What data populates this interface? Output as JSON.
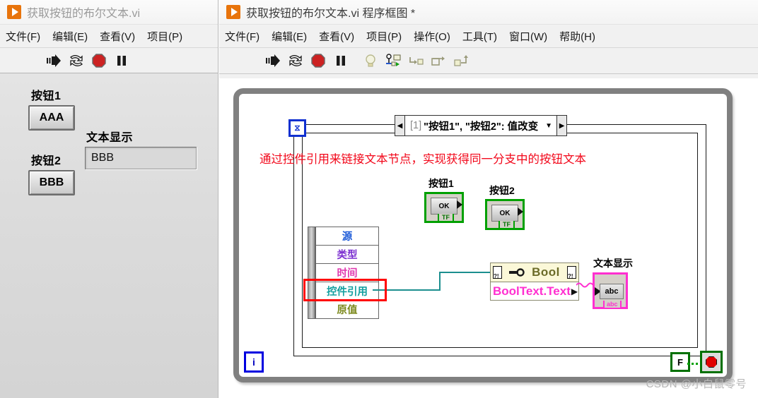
{
  "left_window": {
    "title": "获取按钮的布尔文本.vi",
    "icon": "labview-vi-icon",
    "menu": [
      {
        "label": "文件(F)"
      },
      {
        "label": "编辑(E)"
      },
      {
        "label": "查看(V)"
      },
      {
        "label": "项目(P)"
      }
    ],
    "toolbar": [
      {
        "name": "run-button",
        "glyph": "run-arrow-icon"
      },
      {
        "name": "run-continuously-button",
        "glyph": "run-continuously-icon"
      },
      {
        "name": "abort-execution-button",
        "glyph": "abort-stop-icon"
      },
      {
        "name": "pause-button",
        "glyph": "pause-icon"
      }
    ],
    "front_panel": {
      "button1_label": "按钮1",
      "button1_text": "AAA",
      "button2_label": "按钮2",
      "button2_text": "BBB",
      "indicator_label": "文本显示",
      "indicator_value": "BBB"
    }
  },
  "right_window": {
    "title": "获取按钮的布尔文本.vi 程序框图 *",
    "icon": "labview-vi-icon",
    "menu": [
      {
        "label": "文件(F)"
      },
      {
        "label": "编辑(E)"
      },
      {
        "label": "查看(V)"
      },
      {
        "label": "项目(P)"
      },
      {
        "label": "操作(O)"
      },
      {
        "label": "工具(T)"
      },
      {
        "label": "窗口(W)"
      },
      {
        "label": "帮助(H)"
      }
    ],
    "toolbar": [
      {
        "name": "run-button",
        "glyph": "run-arrow-icon"
      },
      {
        "name": "run-continuously-button",
        "glyph": "run-continuously-icon"
      },
      {
        "name": "abort-execution-button",
        "glyph": "abort-stop-icon"
      },
      {
        "name": "pause-button",
        "glyph": "pause-icon"
      },
      {
        "name": "highlight-execution-button",
        "glyph": "lightbulb-icon"
      },
      {
        "name": "retain-wire-values-button",
        "glyph": "probe-retain-icon"
      },
      {
        "name": "step-into-button",
        "glyph": "step-into-icon"
      },
      {
        "name": "step-over-button",
        "glyph": "step-over-icon"
      },
      {
        "name": "step-out-button",
        "glyph": "step-out-icon"
      }
    ],
    "diagram": {
      "event_case_index": "[1]",
      "event_case_label": "\"按钮1\", \"按钮2\": 值改变",
      "annotation": "通过控件引用来链接文本节点，实现获得同一分支中的按钮文本",
      "terminals": [
        {
          "label": "按钮1",
          "glyph": "OK",
          "type": "TF"
        },
        {
          "label": "按钮2",
          "glyph": "OK",
          "type": "TF"
        }
      ],
      "event_data_node": [
        {
          "label": "源",
          "color": "#1e5bd8"
        },
        {
          "label": "类型",
          "color": "#7b2fd0"
        },
        {
          "label": "时间",
          "color": "#e03ab0"
        },
        {
          "label": "控件引用",
          "color": "#14a0a0",
          "highlighted": true
        },
        {
          "label": "原值",
          "color": "#7d8a1e"
        }
      ],
      "property_node": {
        "title": "Bool",
        "property": "BoolText.Text"
      },
      "indicator": {
        "label": "文本显示",
        "glyph": "abc"
      },
      "loop": {
        "iteration_terminal": "i",
        "stop_constant": "F",
        "conditional_terminal": "stop-sign-icon"
      }
    }
  },
  "watermark": "CSDN @小白鼠零号",
  "colors": {
    "accent_orange": "#e8740c",
    "wire_teal": "#1c8f8f",
    "annotation_red": "#f2071a",
    "bool_green": "#00a000",
    "string_magenta": "#ff2fd0",
    "property_yellow": "#fbf8d8"
  }
}
